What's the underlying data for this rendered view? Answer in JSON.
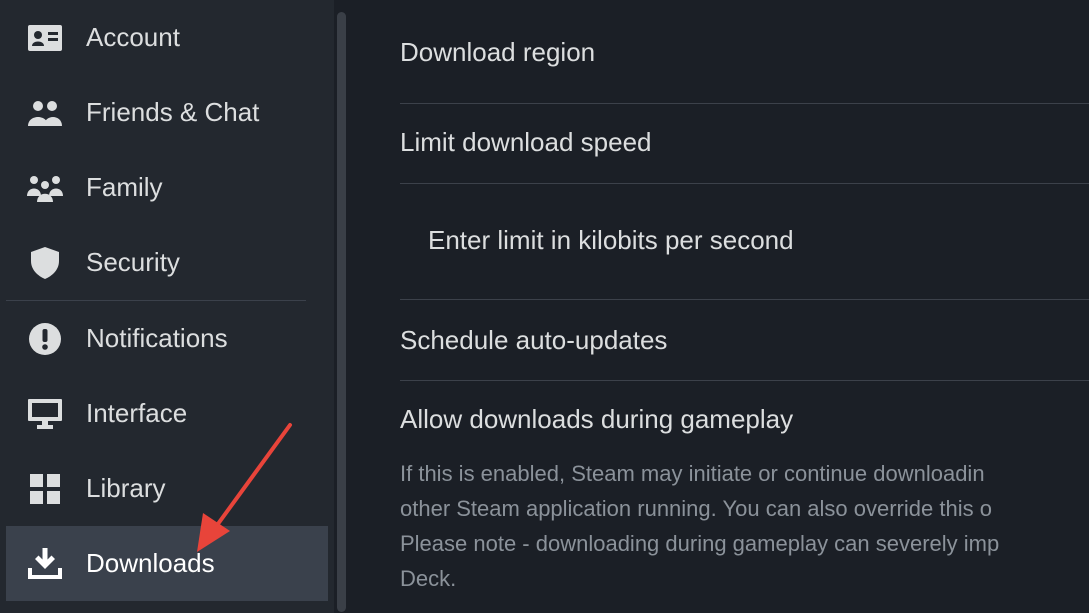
{
  "sidebar": {
    "items": [
      {
        "label": "Account",
        "icon": "account-card-icon"
      },
      {
        "label": "Friends & Chat",
        "icon": "friends-icon"
      },
      {
        "label": "Family",
        "icon": "family-icon"
      },
      {
        "label": "Security",
        "icon": "shield-icon"
      },
      {
        "label": "Notifications",
        "icon": "exclamation-icon"
      },
      {
        "label": "Interface",
        "icon": "monitor-icon"
      },
      {
        "label": "Library",
        "icon": "grid-icon"
      },
      {
        "label": "Downloads",
        "icon": "download-icon"
      }
    ],
    "active": "Downloads"
  },
  "main": {
    "download_region": "Download region",
    "limit_speed": "Limit download speed",
    "limit_input_placeholder": "Enter limit in kilobits per second",
    "schedule_updates": "Schedule auto-updates",
    "allow_gameplay": "Allow downloads during gameplay",
    "description_lines": [
      "If this is enabled, Steam may initiate or continue downloadin",
      "other Steam application running. You can also override this o",
      "Please note - downloading during gameplay can severely imp",
      "Deck."
    ]
  },
  "colors": {
    "sidebar_bg": "#23282f",
    "main_bg": "#1b1f26",
    "active_bg": "#3a414c",
    "annotation_arrow": "#e8443a"
  }
}
